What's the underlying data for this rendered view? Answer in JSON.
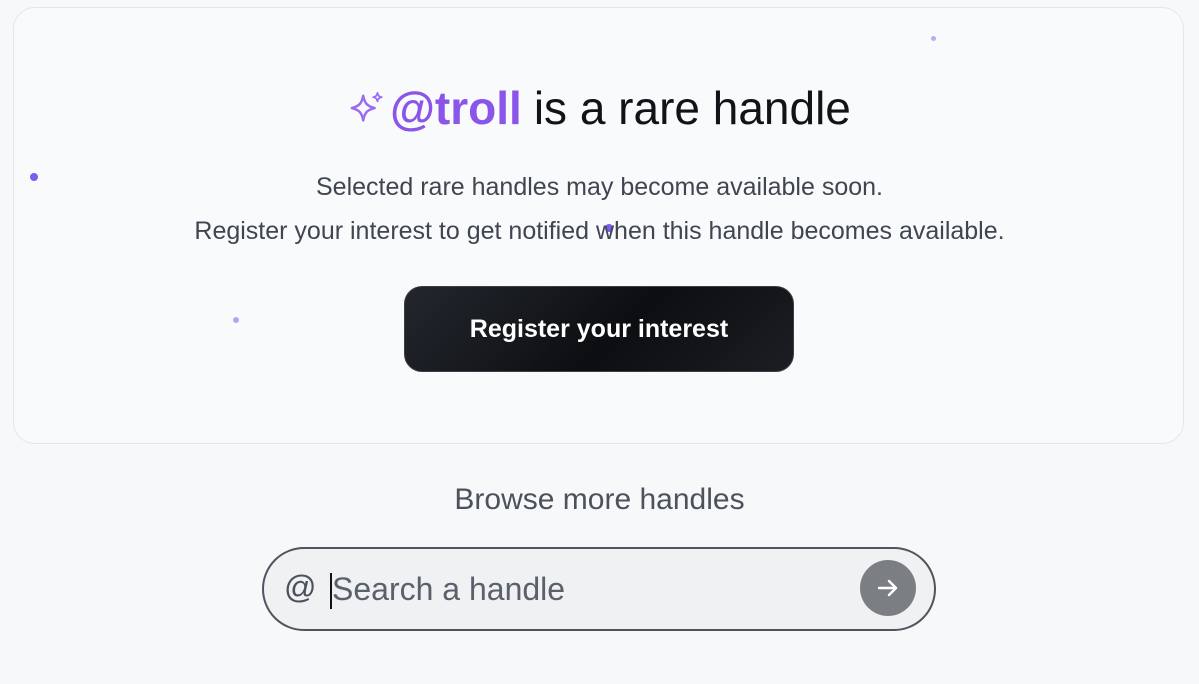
{
  "card": {
    "handle": "@troll",
    "headline_suffix": "is a rare handle",
    "line1": "Selected rare handles may become available soon.",
    "line2": "Register your interest to get notified when this handle becomes available.",
    "register_label": "Register your interest",
    "icon": "sparkle-icon"
  },
  "browse": {
    "title": "Browse more handles",
    "prefix": "@",
    "placeholder": "Search a handle",
    "value": "",
    "submit_icon": "arrow-right-icon"
  },
  "colors": {
    "accent": "#8a55e8",
    "dots": "#7b5cf0",
    "button_bg": "#0c0e11",
    "submit_bg": "#7b7f84"
  }
}
